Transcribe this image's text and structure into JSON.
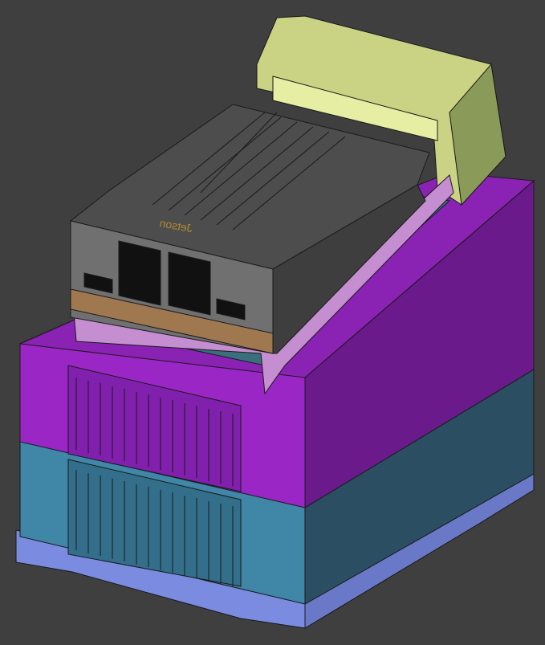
{
  "viewport": {
    "background": "#3f3f3f",
    "model": {
      "parts": [
        {
          "name": "connector-housing",
          "color": "#c9d383"
        },
        {
          "name": "upper-enclosure",
          "color": "#9a26c6"
        },
        {
          "name": "lower-enclosure",
          "color": "#3f86a7"
        },
        {
          "name": "base-plate",
          "color": "#7b8be0"
        },
        {
          "name": "compute-module",
          "color": "#6e6e6e"
        },
        {
          "name": "mounting-bracket",
          "color": "#c48ed0"
        }
      ],
      "logo_text": "Jetson"
    }
  }
}
